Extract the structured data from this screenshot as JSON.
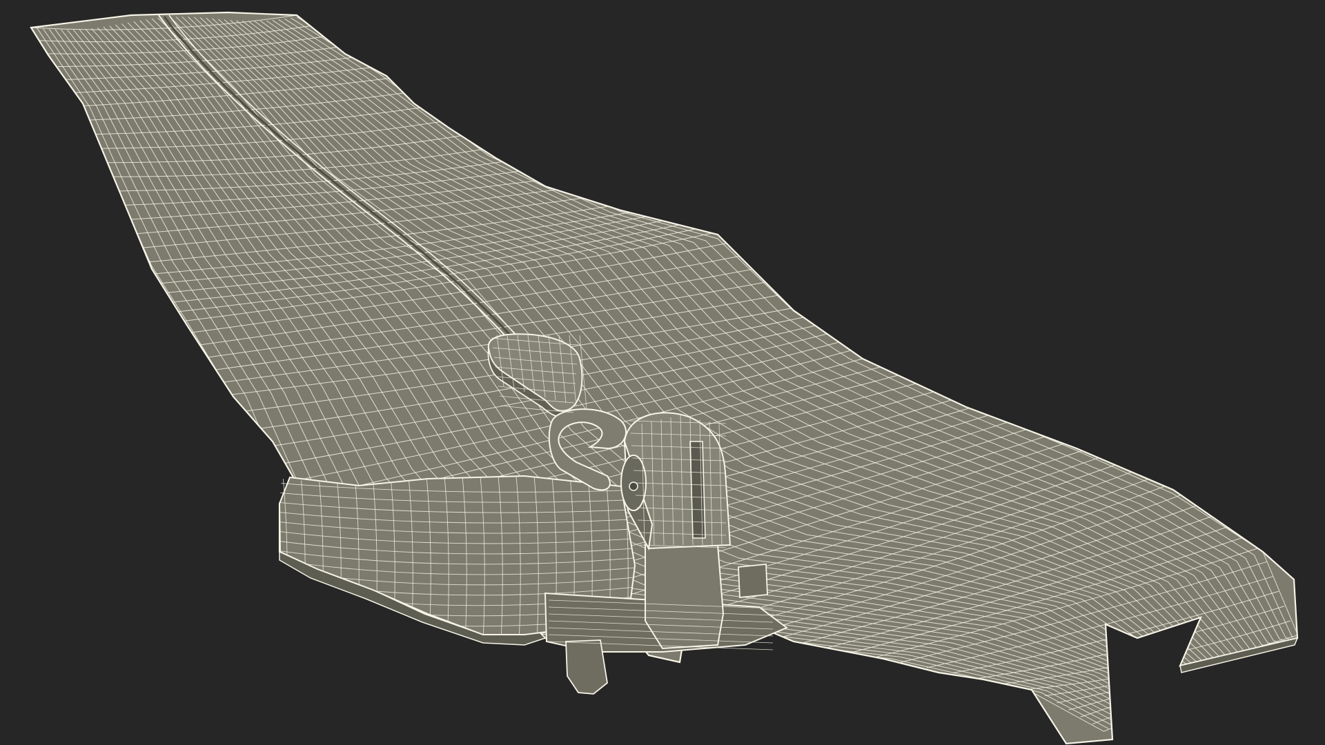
{
  "scene": {
    "subject": "zipper-wireframe-model",
    "render_style": "wireframe-over-shaded",
    "colors": {
      "background": "#262626",
      "surface": "#7c7b6d",
      "surface_dark": "#5e5d52",
      "surface_light": "#8a897b",
      "wire": "#f3f1e3"
    }
  }
}
